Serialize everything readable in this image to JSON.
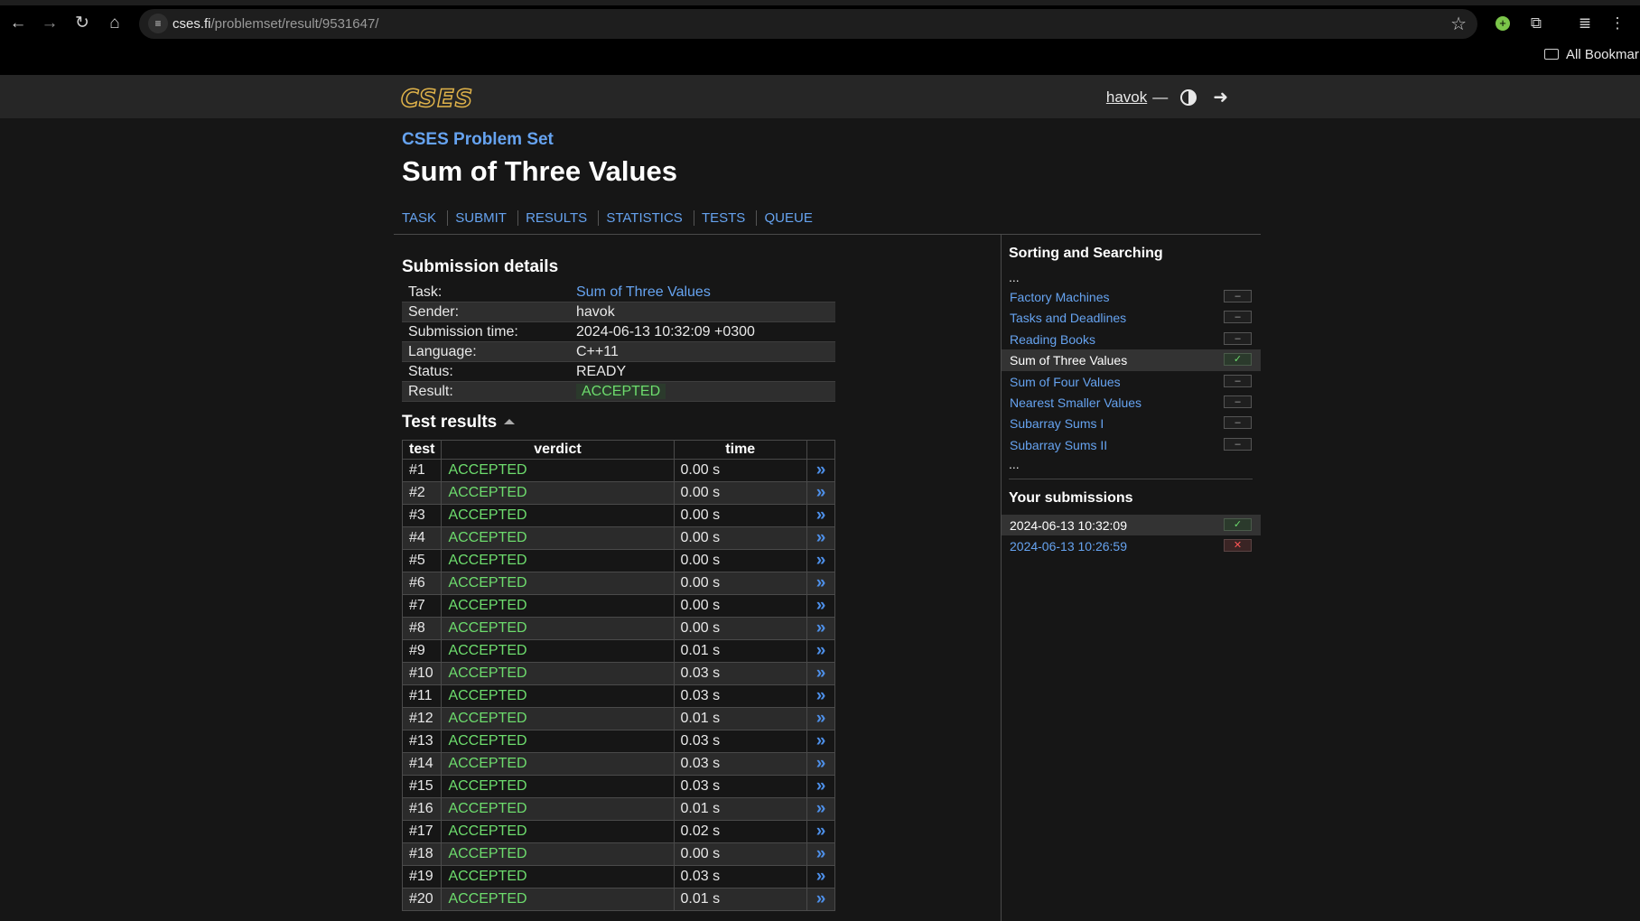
{
  "browser": {
    "url_host": "cses.fi",
    "url_path": "/problemset/result/9531647/",
    "bookmarks_label": "All Bookmar"
  },
  "site": {
    "logo": "CSES",
    "username": "havok",
    "dash": "—"
  },
  "page": {
    "breadcrumb": "CSES Problem Set",
    "title": "Sum of Three Values",
    "tabs": [
      "TASK",
      "SUBMIT",
      "RESULTS",
      "STATISTICS",
      "TESTS",
      "QUEUE"
    ]
  },
  "submission": {
    "heading": "Submission details",
    "rows": [
      {
        "key": "Task:",
        "value": "Sum of Three Values"
      },
      {
        "key": "Sender:",
        "value": "havok"
      },
      {
        "key": "Submission time:",
        "value": "2024-06-13 10:32:09 +0300"
      },
      {
        "key": "Language:",
        "value": "C++11"
      },
      {
        "key": "Status:",
        "value": "READY"
      },
      {
        "key": "Result:",
        "value": "ACCEPTED"
      }
    ]
  },
  "tests": {
    "heading": "Test results",
    "columns": [
      "test",
      "verdict",
      "time"
    ],
    "rows": [
      {
        "test": "#1",
        "verdict": "ACCEPTED",
        "time": "0.00 s"
      },
      {
        "test": "#2",
        "verdict": "ACCEPTED",
        "time": "0.00 s"
      },
      {
        "test": "#3",
        "verdict": "ACCEPTED",
        "time": "0.00 s"
      },
      {
        "test": "#4",
        "verdict": "ACCEPTED",
        "time": "0.00 s"
      },
      {
        "test": "#5",
        "verdict": "ACCEPTED",
        "time": "0.00 s"
      },
      {
        "test": "#6",
        "verdict": "ACCEPTED",
        "time": "0.00 s"
      },
      {
        "test": "#7",
        "verdict": "ACCEPTED",
        "time": "0.00 s"
      },
      {
        "test": "#8",
        "verdict": "ACCEPTED",
        "time": "0.00 s"
      },
      {
        "test": "#9",
        "verdict": "ACCEPTED",
        "time": "0.01 s"
      },
      {
        "test": "#10",
        "verdict": "ACCEPTED",
        "time": "0.03 s"
      },
      {
        "test": "#11",
        "verdict": "ACCEPTED",
        "time": "0.03 s"
      },
      {
        "test": "#12",
        "verdict": "ACCEPTED",
        "time": "0.01 s"
      },
      {
        "test": "#13",
        "verdict": "ACCEPTED",
        "time": "0.03 s"
      },
      {
        "test": "#14",
        "verdict": "ACCEPTED",
        "time": "0.03 s"
      },
      {
        "test": "#15",
        "verdict": "ACCEPTED",
        "time": "0.03 s"
      },
      {
        "test": "#16",
        "verdict": "ACCEPTED",
        "time": "0.01 s"
      },
      {
        "test": "#17",
        "verdict": "ACCEPTED",
        "time": "0.02 s"
      },
      {
        "test": "#18",
        "verdict": "ACCEPTED",
        "time": "0.00 s"
      },
      {
        "test": "#19",
        "verdict": "ACCEPTED",
        "time": "0.03 s"
      },
      {
        "test": "#20",
        "verdict": "ACCEPTED",
        "time": "0.01 s"
      }
    ],
    "link_glyph": "»"
  },
  "sidebar": {
    "section_title": "Sorting and Searching",
    "ellipsis": "...",
    "tasks": [
      {
        "label": "Factory Machines",
        "status": "none",
        "mark": "–"
      },
      {
        "label": "Tasks and Deadlines",
        "status": "none",
        "mark": "–"
      },
      {
        "label": "Reading Books",
        "status": "none",
        "mark": "–"
      },
      {
        "label": "Sum of Three Values",
        "status": "solved",
        "mark": "✓"
      },
      {
        "label": "Sum of Four Values",
        "status": "none",
        "mark": "–"
      },
      {
        "label": "Nearest Smaller Values",
        "status": "none",
        "mark": "–"
      },
      {
        "label": "Subarray Sums I",
        "status": "none",
        "mark": "–"
      },
      {
        "label": "Subarray Sums II",
        "status": "none",
        "mark": "–"
      }
    ],
    "submissions_title": "Your submissions",
    "submissions": [
      {
        "label": "2024-06-13 10:32:09",
        "status": "solved",
        "mark": "✓"
      },
      {
        "label": "2024-06-13 10:26:59",
        "status": "failed",
        "mark": "✕"
      }
    ]
  },
  "colors": {
    "accepted": "#6ddc6d",
    "link": "#66a3f0",
    "logo": "#e0b34a",
    "background": "#161616"
  }
}
